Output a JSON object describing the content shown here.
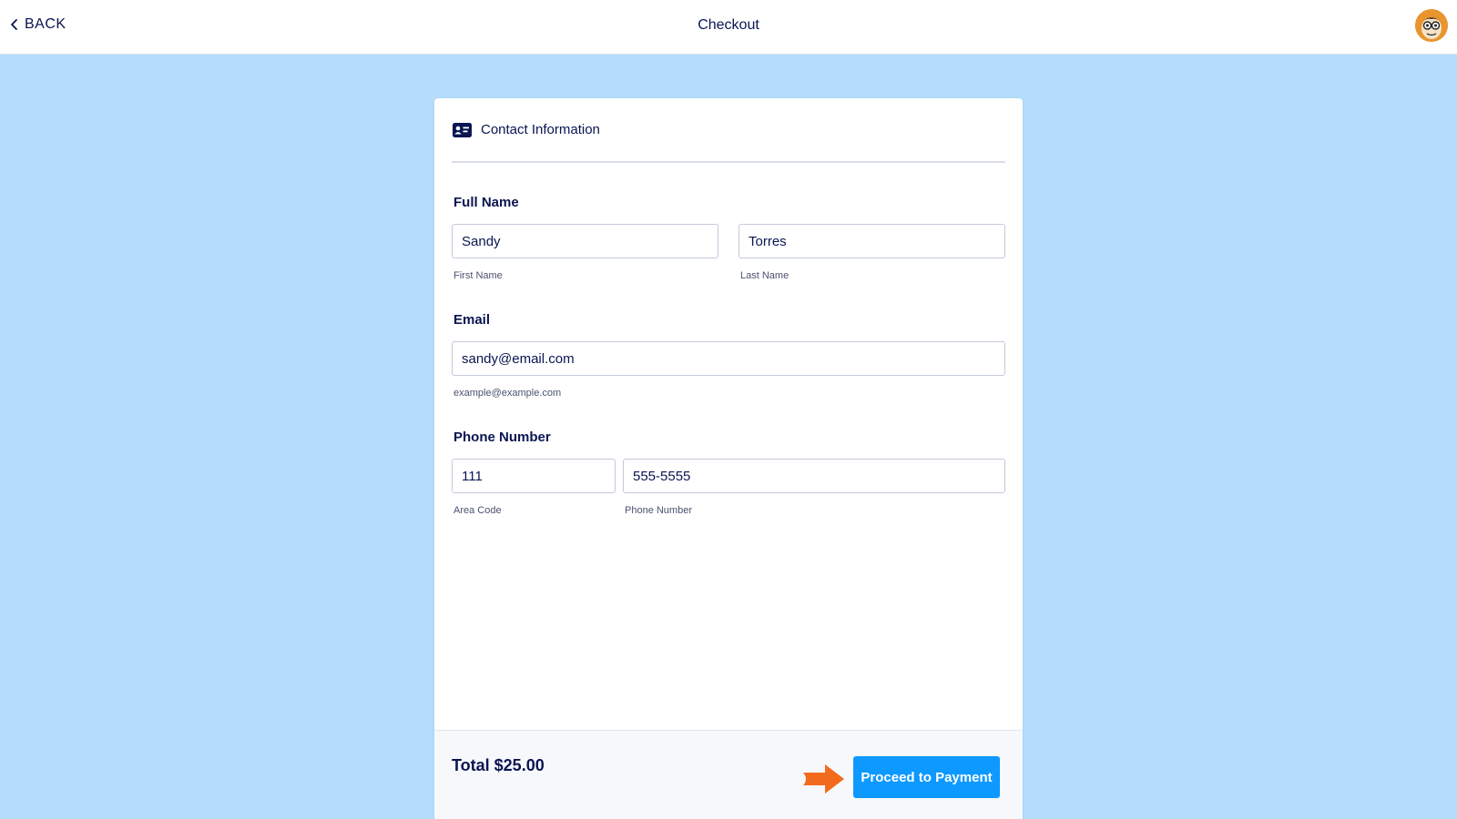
{
  "header": {
    "back_label": "BACK",
    "title": "Checkout"
  },
  "section": {
    "title": "Contact Information",
    "icon": "contact-card-icon"
  },
  "fields": {
    "full_name": {
      "label": "Full Name",
      "first_value": "Sandy",
      "first_sublabel": "First Name",
      "last_value": "Torres",
      "last_sublabel": "Last Name"
    },
    "email": {
      "label": "Email",
      "value": "sandy@email.com",
      "sublabel": "example@example.com"
    },
    "phone": {
      "label": "Phone Number",
      "area_value": "111",
      "area_sublabel": "Area Code",
      "number_value": "555-5555",
      "number_sublabel": "Phone Number"
    }
  },
  "footer": {
    "total": "Total $25.00",
    "proceed_label": "Proceed to Payment"
  },
  "colors": {
    "background": "#b3ddfb",
    "text": "#0a1551",
    "button": "#0d99ff",
    "arrow": "#f26b1d"
  }
}
